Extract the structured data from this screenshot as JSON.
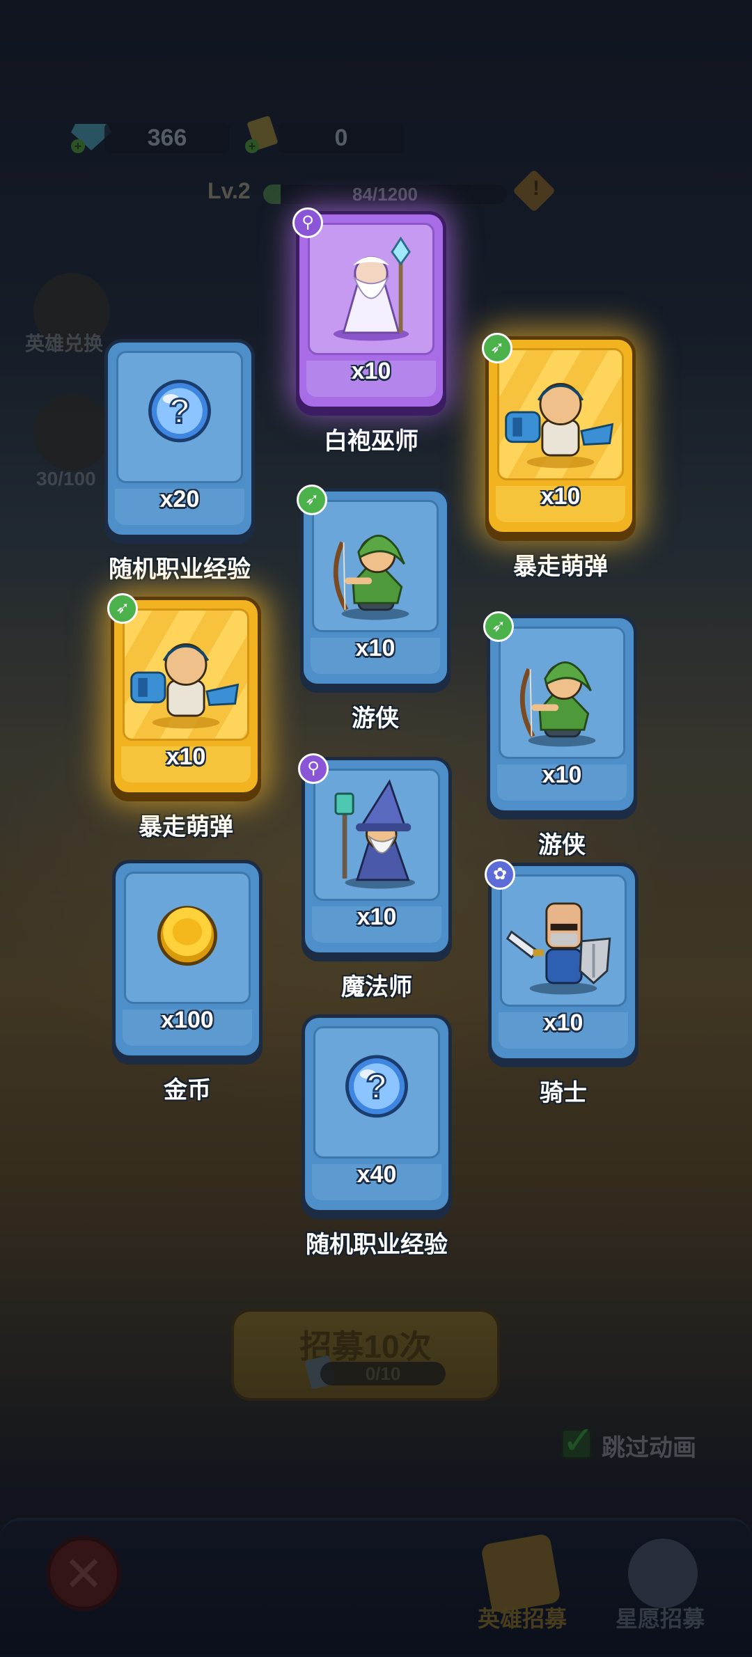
{
  "resources": {
    "gems": "366",
    "tickets": "0"
  },
  "player": {
    "level_label": "Lv.2",
    "exp_text": "84/1200",
    "exp_fraction": 0.07
  },
  "side": {
    "hero_exchange_label": "英雄兑换",
    "progress_label": "30/100"
  },
  "recruit": {
    "button_label": "招募10次",
    "progress_text": "0/10"
  },
  "skip": {
    "label": "跳过动画",
    "checked": true
  },
  "tabs": [
    {
      "label": "英雄招募",
      "active": true
    },
    {
      "label": "星愿招募",
      "active": false
    }
  ],
  "rewards": [
    {
      "id": "white-robe-wizard",
      "name": "白袍巫师",
      "count": "x10",
      "rarity": "purple",
      "class": "mage",
      "icon": "white-robe-wizard-icon"
    },
    {
      "id": "random-exp-1",
      "name": "随机职业经验",
      "count": "x20",
      "rarity": "blue",
      "class": "",
      "icon": "question-orb-icon"
    },
    {
      "id": "berserk-bomber-1",
      "name": "暴走萌弹",
      "count": "x10",
      "rarity": "gold",
      "class": "ranger",
      "icon": "bomber-hero-icon"
    },
    {
      "id": "ranger-1",
      "name": "游侠",
      "count": "x10",
      "rarity": "blue",
      "class": "ranger",
      "icon": "ranger-hero-icon"
    },
    {
      "id": "berserk-bomber-2",
      "name": "暴走萌弹",
      "count": "x10",
      "rarity": "gold",
      "class": "ranger",
      "icon": "bomber-hero-icon"
    },
    {
      "id": "ranger-2",
      "name": "游侠",
      "count": "x10",
      "rarity": "blue",
      "class": "ranger",
      "icon": "ranger-hero-icon"
    },
    {
      "id": "mage",
      "name": "魔法师",
      "count": "x10",
      "rarity": "blue",
      "class": "mage",
      "icon": "mage-hero-icon"
    },
    {
      "id": "gold-coin",
      "name": "金币",
      "count": "x100",
      "rarity": "blue",
      "class": "",
      "icon": "gold-coin-icon"
    },
    {
      "id": "knight",
      "name": "骑士",
      "count": "x10",
      "rarity": "blue",
      "class": "knight",
      "icon": "knight-hero-icon"
    },
    {
      "id": "random-exp-2",
      "name": "随机职业经验",
      "count": "x40",
      "rarity": "blue",
      "class": "",
      "icon": "question-orb-icon"
    }
  ],
  "colors": {
    "blue_card": "#4f8fc9",
    "purple_card": "#a76ce6",
    "gold_card": "#f2b320",
    "ranger_badge": "#4bb14b",
    "mage_badge": "#8b55d8",
    "knight_badge": "#5b6cd8"
  }
}
